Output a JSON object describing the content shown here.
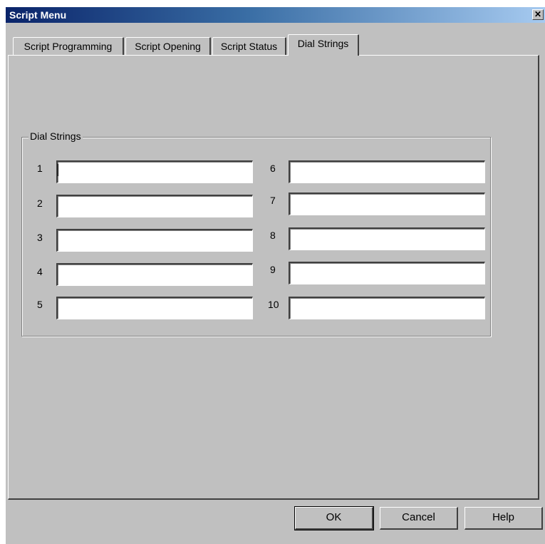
{
  "window": {
    "title": "Script Menu",
    "close_glyph": "✕"
  },
  "tabs": [
    {
      "label": "Script Programming",
      "active": false
    },
    {
      "label": "Script Opening",
      "active": false
    },
    {
      "label": "Script Status",
      "active": false
    },
    {
      "label": "Dial Strings",
      "active": true
    }
  ],
  "group": {
    "label": "Dial Strings",
    "fields": [
      {
        "number": "1",
        "value": ""
      },
      {
        "number": "2",
        "value": ""
      },
      {
        "number": "3",
        "value": ""
      },
      {
        "number": "4",
        "value": ""
      },
      {
        "number": "5",
        "value": ""
      },
      {
        "number": "6",
        "value": ""
      },
      {
        "number": "7",
        "value": ""
      },
      {
        "number": "8",
        "value": ""
      },
      {
        "number": "9",
        "value": ""
      },
      {
        "number": "10",
        "value": ""
      }
    ]
  },
  "buttons": {
    "ok": "OK",
    "cancel": "Cancel",
    "help": "Help"
  }
}
